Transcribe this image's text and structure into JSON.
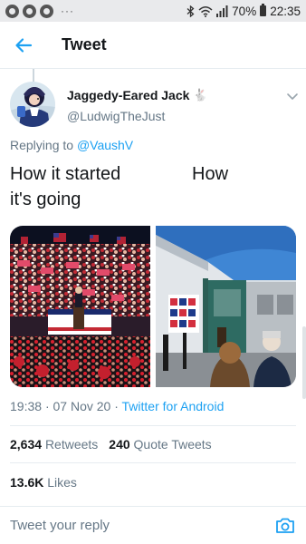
{
  "status_bar": {
    "dots": "···",
    "battery": "70%",
    "time": "22:35"
  },
  "header": {
    "title": "Tweet"
  },
  "tweet": {
    "author": {
      "display_name": "Jaggedy-Eared Jack",
      "name_emoji": "🐇",
      "handle": "@LudwigTheJust"
    },
    "replying": {
      "prefix": "Replying to",
      "target": "@VaushV"
    },
    "text": {
      "part1": "How it started",
      "part2": "How",
      "part3": "it's going"
    },
    "meta": {
      "time": "19:38",
      "sep1": "·",
      "date": "07 Nov 20",
      "sep2": "·",
      "source": "Twitter for Android"
    },
    "stats": {
      "retweets_count": "2,634",
      "retweets_label": "Retweets",
      "quotes_count": "240",
      "quotes_label": "Quote Tweets",
      "likes_count": "13.6K",
      "likes_label": "Likes"
    }
  },
  "reply": {
    "placeholder": "Tweet your reply"
  },
  "colors": {
    "accent": "#1da1f2",
    "secondary_text": "#657786",
    "primary_text": "#14171a",
    "divider": "#e6ecf0"
  },
  "icons": {
    "back": "arrow-left-icon",
    "more": "chevron-down-icon",
    "camera": "camera-icon",
    "bluetooth": "bluetooth-icon",
    "wifi": "wifi-icon",
    "signal": "signal-icon",
    "battery": "battery-icon"
  }
}
